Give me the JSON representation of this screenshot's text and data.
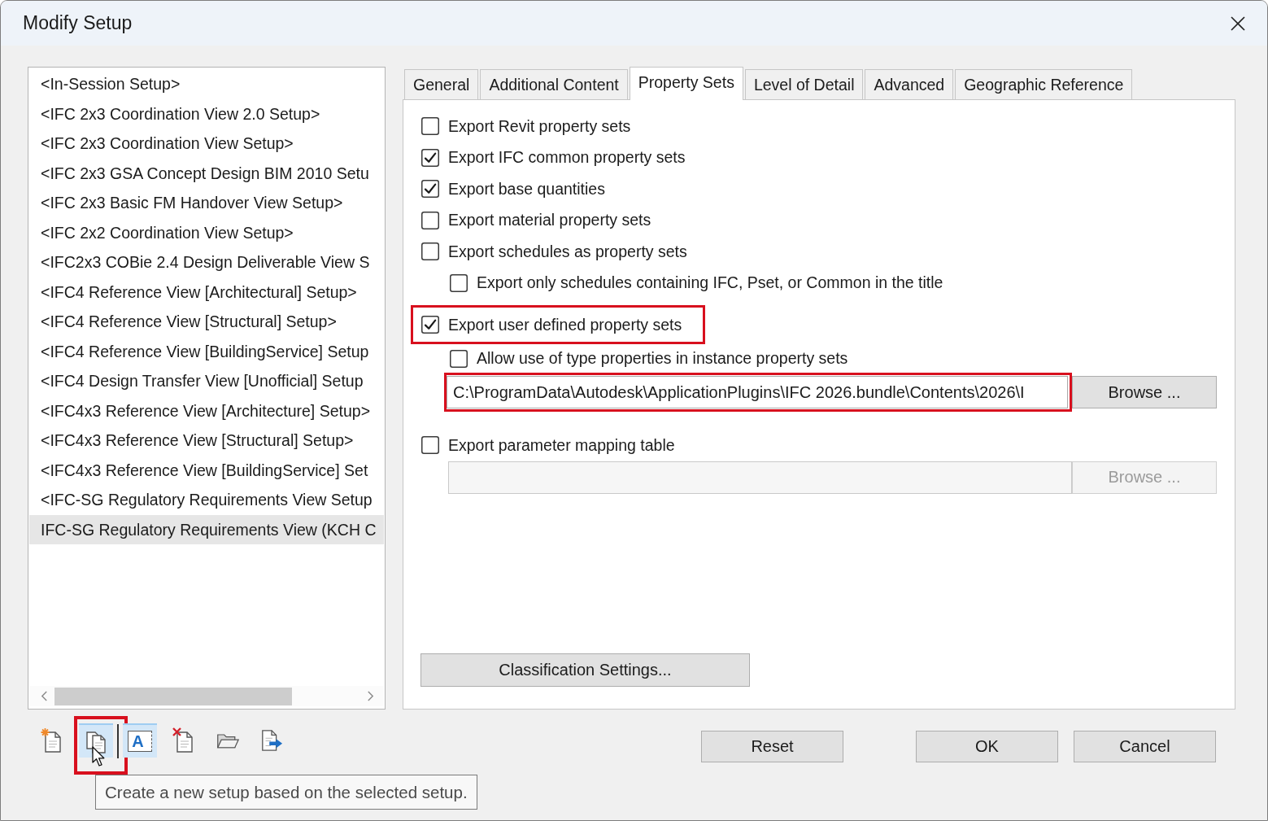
{
  "window": {
    "title": "Modify Setup"
  },
  "setups": [
    {
      "label": "<In-Session Setup>",
      "selected": false
    },
    {
      "label": "<IFC 2x3 Coordination View 2.0 Setup>",
      "selected": false
    },
    {
      "label": "<IFC 2x3 Coordination View Setup>",
      "selected": false
    },
    {
      "label": "<IFC 2x3 GSA Concept Design BIM 2010 Setu",
      "selected": false
    },
    {
      "label": "<IFC 2x3 Basic FM Handover View Setup>",
      "selected": false
    },
    {
      "label": "<IFC 2x2 Coordination View Setup>",
      "selected": false
    },
    {
      "label": "<IFC2x3 COBie 2.4 Design Deliverable View S",
      "selected": false
    },
    {
      "label": "<IFC4 Reference View [Architectural] Setup>",
      "selected": false
    },
    {
      "label": "<IFC4 Reference View [Structural] Setup>",
      "selected": false
    },
    {
      "label": "<IFC4 Reference View [BuildingService] Setup",
      "selected": false
    },
    {
      "label": "<IFC4 Design Transfer View [Unofficial] Setup",
      "selected": false
    },
    {
      "label": "<IFC4x3 Reference View [Architecture] Setup>",
      "selected": false
    },
    {
      "label": "<IFC4x3 Reference View [Structural] Setup>",
      "selected": false
    },
    {
      "label": "<IFC4x3 Reference View [BuildingService] Set",
      "selected": false
    },
    {
      "label": "<IFC-SG Regulatory Requirements View Setup",
      "selected": false
    },
    {
      "label": "IFC-SG Regulatory Requirements View (KCH C",
      "selected": true
    }
  ],
  "toolbar": [
    {
      "kind": "new",
      "shaded": false,
      "highlighted": false,
      "pointer": false,
      "separator_after": false
    },
    {
      "kind": "copy",
      "shaded": true,
      "highlighted": true,
      "pointer": true,
      "separator_after": true
    },
    {
      "kind": "rename",
      "glyph": "A",
      "shaded": true,
      "highlighted": false,
      "pointer": false,
      "separator_after": false
    },
    {
      "kind": "delete",
      "shaded": false,
      "highlighted": false,
      "pointer": false,
      "separator_after": false
    },
    {
      "kind": "open",
      "shaded": false,
      "highlighted": false,
      "pointer": false,
      "separator_after": false
    },
    {
      "kind": "export",
      "shaded": false,
      "highlighted": false,
      "pointer": false,
      "separator_after": false
    }
  ],
  "tooltip": "Create a new setup based on the selected setup.",
  "tabs": [
    {
      "label": "General",
      "selected": false
    },
    {
      "label": "Additional Content",
      "selected": false
    },
    {
      "label": "Property Sets",
      "selected": true
    },
    {
      "label": "Level of Detail",
      "selected": false
    },
    {
      "label": "Advanced",
      "selected": false
    },
    {
      "label": "Geographic Reference",
      "selected": false
    }
  ],
  "property_sets": {
    "options": [
      {
        "label": "Export Revit property sets",
        "checked": false,
        "highlighted": false
      },
      {
        "label": "Export IFC common property sets",
        "checked": true,
        "highlighted": false
      },
      {
        "label": "Export base quantities",
        "checked": true,
        "highlighted": false
      },
      {
        "label": "Export material property sets",
        "checked": false,
        "highlighted": false
      },
      {
        "label": "Export schedules as property sets",
        "checked": false,
        "highlighted": false,
        "children": [
          {
            "label": "Export only schedules containing IFC, Pset, or Common in the title",
            "checked": false
          }
        ]
      },
      {
        "label": "Export user defined property sets",
        "checked": true,
        "highlighted": true,
        "children": [
          {
            "label": "Allow use of type properties in instance property sets",
            "checked": false
          }
        ],
        "file": {
          "value": "C:\\ProgramData\\Autodesk\\ApplicationPlugins\\IFC 2026.bundle\\Contents\\2026\\I",
          "disabled": false,
          "highlighted": true,
          "browse": {
            "label": "Browse ...",
            "disabled": false
          }
        }
      },
      {
        "label": "Export parameter mapping table",
        "checked": false,
        "highlighted": false,
        "file": {
          "disabled": true,
          "highlighted": false,
          "browse": {
            "label": "Browse ...",
            "disabled": true
          }
        }
      }
    ],
    "classification_button": "Classification Settings..."
  },
  "buttons": [
    "Reset",
    "OK",
    "Cancel"
  ]
}
